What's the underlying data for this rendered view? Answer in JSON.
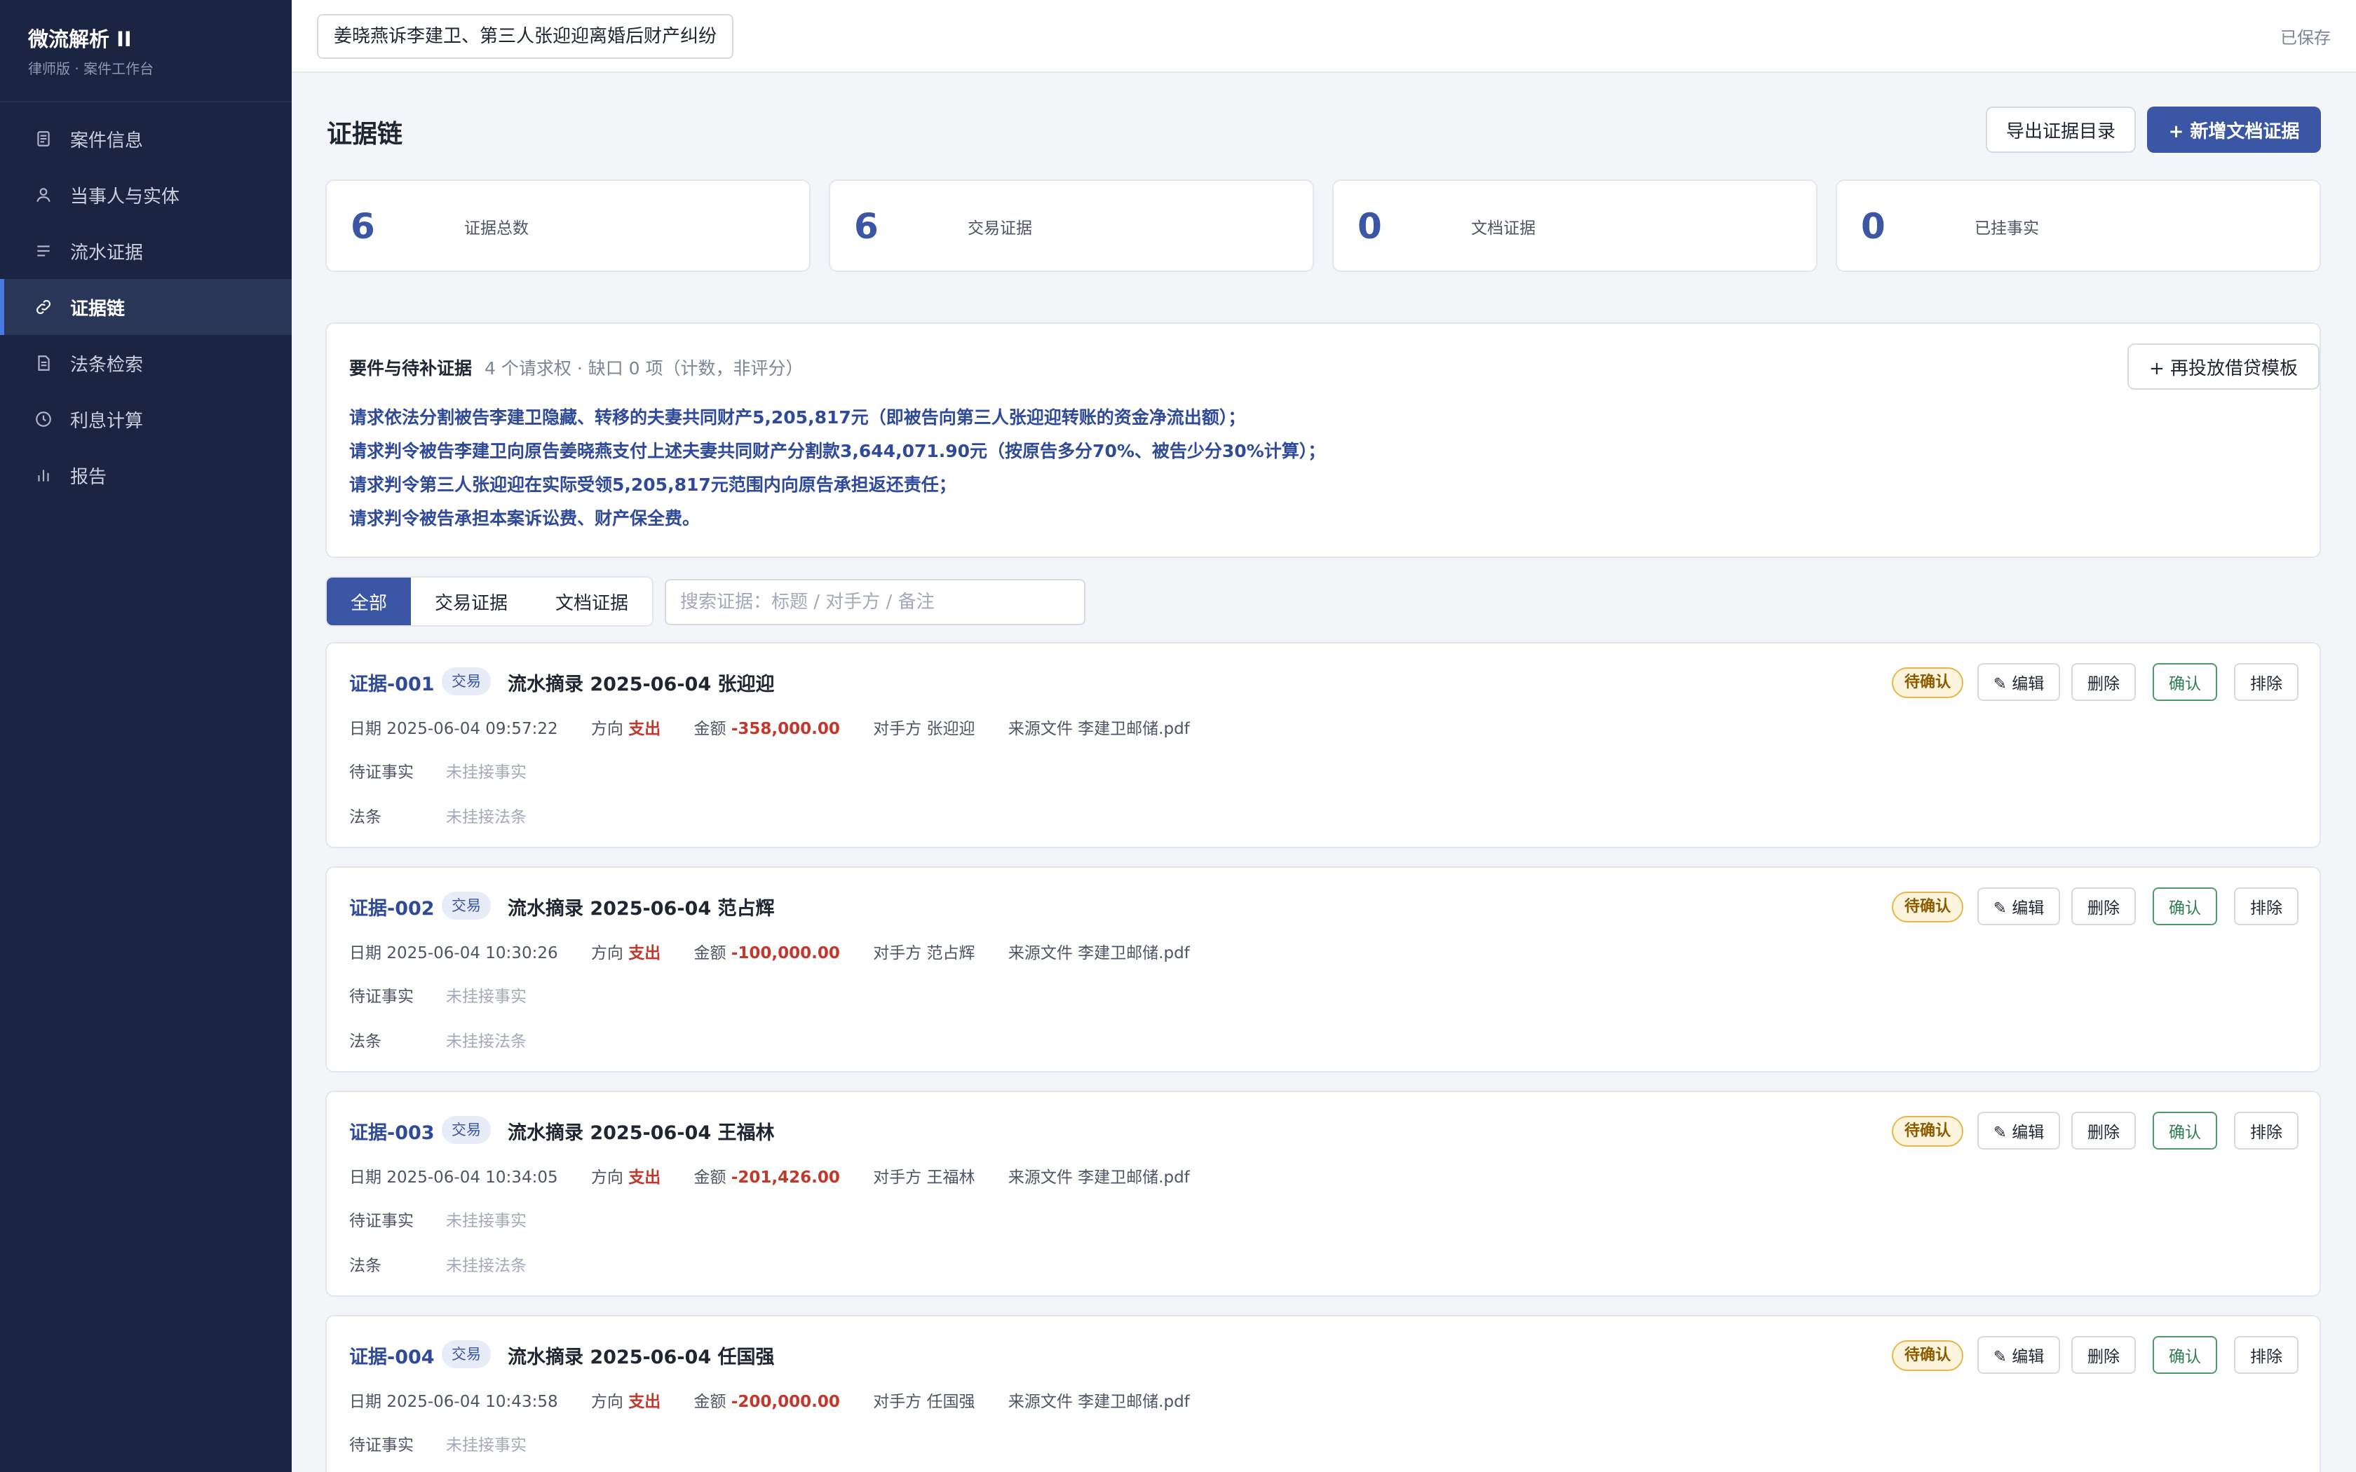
{
  "sidebar": {
    "brand_title": "微流解析 II",
    "brand_subtitle": "律师版 · 案件工作台",
    "items": [
      {
        "label": "案件信息",
        "icon": "document-icon"
      },
      {
        "label": "当事人与实体",
        "icon": "user-icon"
      },
      {
        "label": "流水证据",
        "icon": "list-icon"
      },
      {
        "label": "证据链",
        "icon": "link-icon",
        "active": true
      },
      {
        "label": "法条检索",
        "icon": "file-text-icon"
      },
      {
        "label": "利息计算",
        "icon": "clock-icon"
      },
      {
        "label": "报告",
        "icon": "bar-chart-icon"
      }
    ]
  },
  "topbar": {
    "case_title": "姜晓燕诉李建卫、第三人张迎迎离婚后财产纠纷",
    "save_status": "已保存"
  },
  "page": {
    "title": "证据链",
    "export_button": "导出证据目录",
    "new_button": "+ 新增文档证据"
  },
  "stats": [
    {
      "value": "6",
      "label": "证据总数"
    },
    {
      "value": "6",
      "label": "交易证据"
    },
    {
      "value": "0",
      "label": "文档证据"
    },
    {
      "value": "0",
      "label": "已挂事实"
    }
  ],
  "requirements": {
    "title": "要件与待补证据",
    "summary": "4 个请求权 · 缺口 0 项（计数，非评分）",
    "template_button": "+ 再投放借贷模板",
    "lines": [
      "请求依法分割被告李建卫隐藏、转移的夫妻共同财产5,205,817元（即被告向第三人张迎迎转账的资金净流出额）；",
      "请求判令被告李建卫向原告姜晓燕支付上述夫妻共同财产分割款3,644,071.90元（按原告多分70%、被告少分30%计算）；",
      "请求判令第三人张迎迎在实际受领5,205,817元范围内向原告承担返还责任；",
      "请求判令被告承担本案诉讼费、财产保全费。"
    ]
  },
  "filter": {
    "tabs": [
      "全部",
      "交易证据",
      "文档证据"
    ],
    "active_tab": "全部",
    "search_placeholder": "搜索证据：标题 / 对手方 / 备注",
    "search_value": ""
  },
  "labels": {
    "date": "日期",
    "direction": "方向",
    "amount": "金额",
    "counterparty": "对手方",
    "source": "来源文件",
    "fact": "待证事实",
    "law": "法条",
    "fact_placeholder": "未挂接事实",
    "law_placeholder": "未挂接法条",
    "status": "待确认",
    "edit": "✎ 编辑",
    "delete": "删除",
    "confirm": "确认",
    "exclude": "排除"
  },
  "evidence": [
    {
      "id": "证据-001",
      "type": "交易",
      "title": "流水摘录 2025-06-04 张迎迎",
      "date": "2025-06-04 09:57:22",
      "direction": "支出",
      "amount": "-358,000.00",
      "counterparty": "张迎迎",
      "source": "李建卫邮储.pdf"
    },
    {
      "id": "证据-002",
      "type": "交易",
      "title": "流水摘录 2025-06-04 范占辉",
      "date": "2025-06-04 10:30:26",
      "direction": "支出",
      "amount": "-100,000.00",
      "counterparty": "范占辉",
      "source": "李建卫邮储.pdf"
    },
    {
      "id": "证据-003",
      "type": "交易",
      "title": "流水摘录 2025-06-04 王福林",
      "date": "2025-06-04 10:34:05",
      "direction": "支出",
      "amount": "-201,426.00",
      "counterparty": "王福林",
      "source": "李建卫邮储.pdf"
    },
    {
      "id": "证据-004",
      "type": "交易",
      "title": "流水摘录 2025-06-04 任国强",
      "date": "2025-06-04 10:43:58",
      "direction": "支出",
      "amount": "-200,000.00",
      "counterparty": "任国强",
      "source": "李建卫邮储.pdf"
    }
  ],
  "colors": {
    "sidebar_bg": "#1b2440",
    "accent": "#3b56a4",
    "expense": "#c0392b",
    "pending": "#e6b64a",
    "confirm": "#2e7d52"
  }
}
